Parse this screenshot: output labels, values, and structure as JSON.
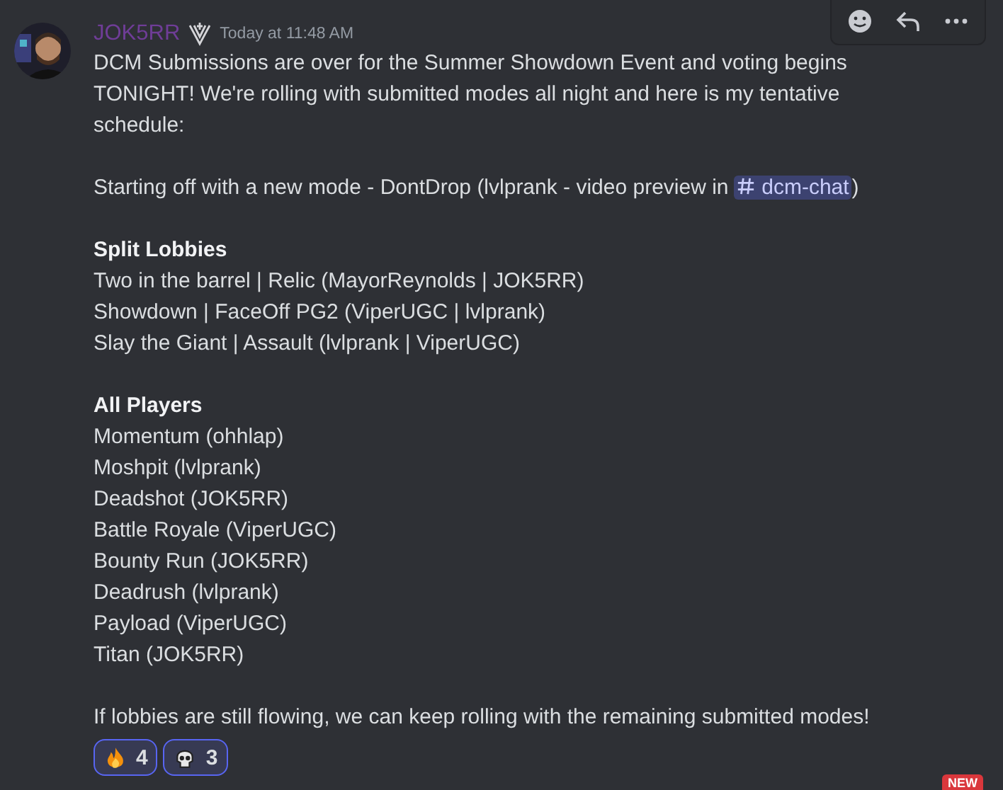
{
  "message": {
    "author": "JOK5RR",
    "timestamp": "Today at 11:48 AM",
    "blocks": [
      {
        "kind": "lines",
        "lines": [
          "DCM Submissions are over for the Summer Showdown Event and voting begins",
          "TONIGHT! We're rolling with submitted modes all night and here is my tentative",
          "schedule:"
        ]
      },
      {
        "kind": "mention",
        "before": "Starting off with a new mode - DontDrop (lvlprank - video preview in",
        "channel": "dcm-chat",
        "after": ")"
      },
      {
        "kind": "section",
        "heading": "Split Lobbies",
        "lines": [
          "Two in the barrel | Relic (MayorReynolds | JOK5RR)",
          "Showdown | FaceOff PG2 (ViperUGC | lvlprank)",
          "Slay the Giant | Assault (lvlprank | ViperUGC)"
        ]
      },
      {
        "kind": "section",
        "heading": "All Players",
        "lines": [
          "Momentum (ohhlap)",
          "Moshpit (lvlprank)",
          "Deadshot (JOK5RR)",
          "Battle Royale (ViperUGC)",
          "Bounty Run (JOK5RR)",
          "Deadrush (lvlprank)",
          "Payload (ViperUGC)",
          "Titan (JOK5RR)"
        ]
      },
      {
        "kind": "lines",
        "lines": [
          "If lobbies are still flowing, we can keep rolling with the remaining submitted modes!"
        ]
      }
    ],
    "reactions": [
      {
        "kind": "fire",
        "count": "4",
        "selected": true
      },
      {
        "kind": "skull",
        "count": "3",
        "selected": true
      }
    ]
  },
  "badge": "NEW"
}
